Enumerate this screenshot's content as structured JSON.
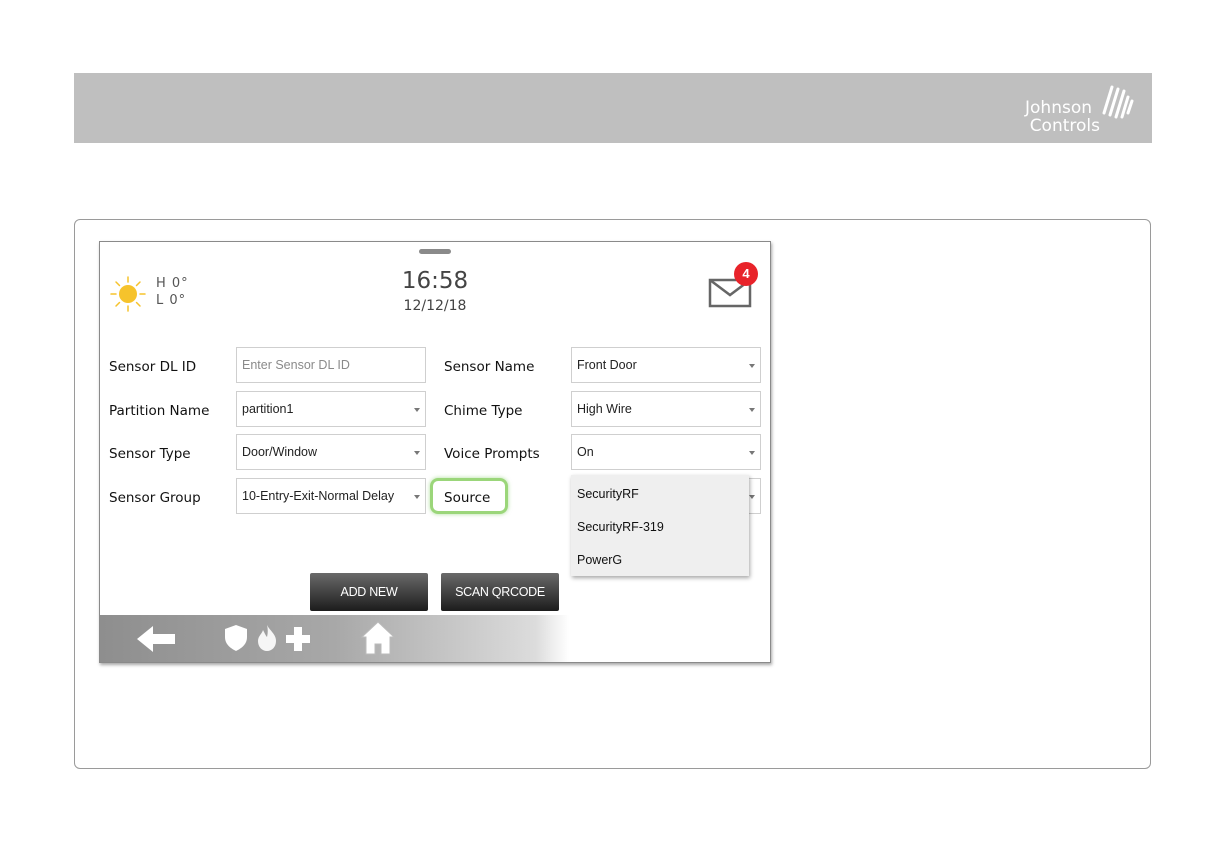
{
  "banner": {
    "brand_line1": "Johnson",
    "brand_line2": "Controls"
  },
  "status": {
    "weather_icon": "sun-icon",
    "temp_high": "H 0°",
    "temp_low": "L 0°",
    "time": "16:58",
    "date": "12/12/18",
    "messages_icon": "envelope-icon",
    "message_count": "4"
  },
  "form": {
    "sensor_dl_id": {
      "label": "Sensor DL ID",
      "placeholder": "Enter Sensor DL ID",
      "value": ""
    },
    "partition_name": {
      "label": "Partition Name",
      "value": "partition1"
    },
    "sensor_type": {
      "label": "Sensor Type",
      "value": "Door/Window"
    },
    "sensor_group": {
      "label": "Sensor Group",
      "value": "10-Entry-Exit-Normal Delay"
    },
    "sensor_name": {
      "label": "Sensor Name",
      "value": "Front Door"
    },
    "chime_type": {
      "label": "Chime Type",
      "value": "High Wire"
    },
    "voice_prompts": {
      "label": "Voice Prompts",
      "value": "On"
    },
    "source": {
      "label": "Source"
    }
  },
  "source_dropdown": {
    "options": [
      "SecurityRF",
      "SecurityRF-319",
      "PowerG"
    ]
  },
  "buttons": {
    "add_new": "ADD NEW",
    "scan_qrcode": "SCAN QRCODE"
  },
  "navbar": {
    "icons": [
      "back-arrow-icon",
      "shield-icon",
      "fire-icon",
      "medical-cross-icon",
      "home-icon"
    ]
  },
  "colors": {
    "banner_gray": "#bfbfbf",
    "badge_red": "#e8232a",
    "highlight_green": "#9bd67a",
    "sun_yellow": "#f6c32c"
  }
}
